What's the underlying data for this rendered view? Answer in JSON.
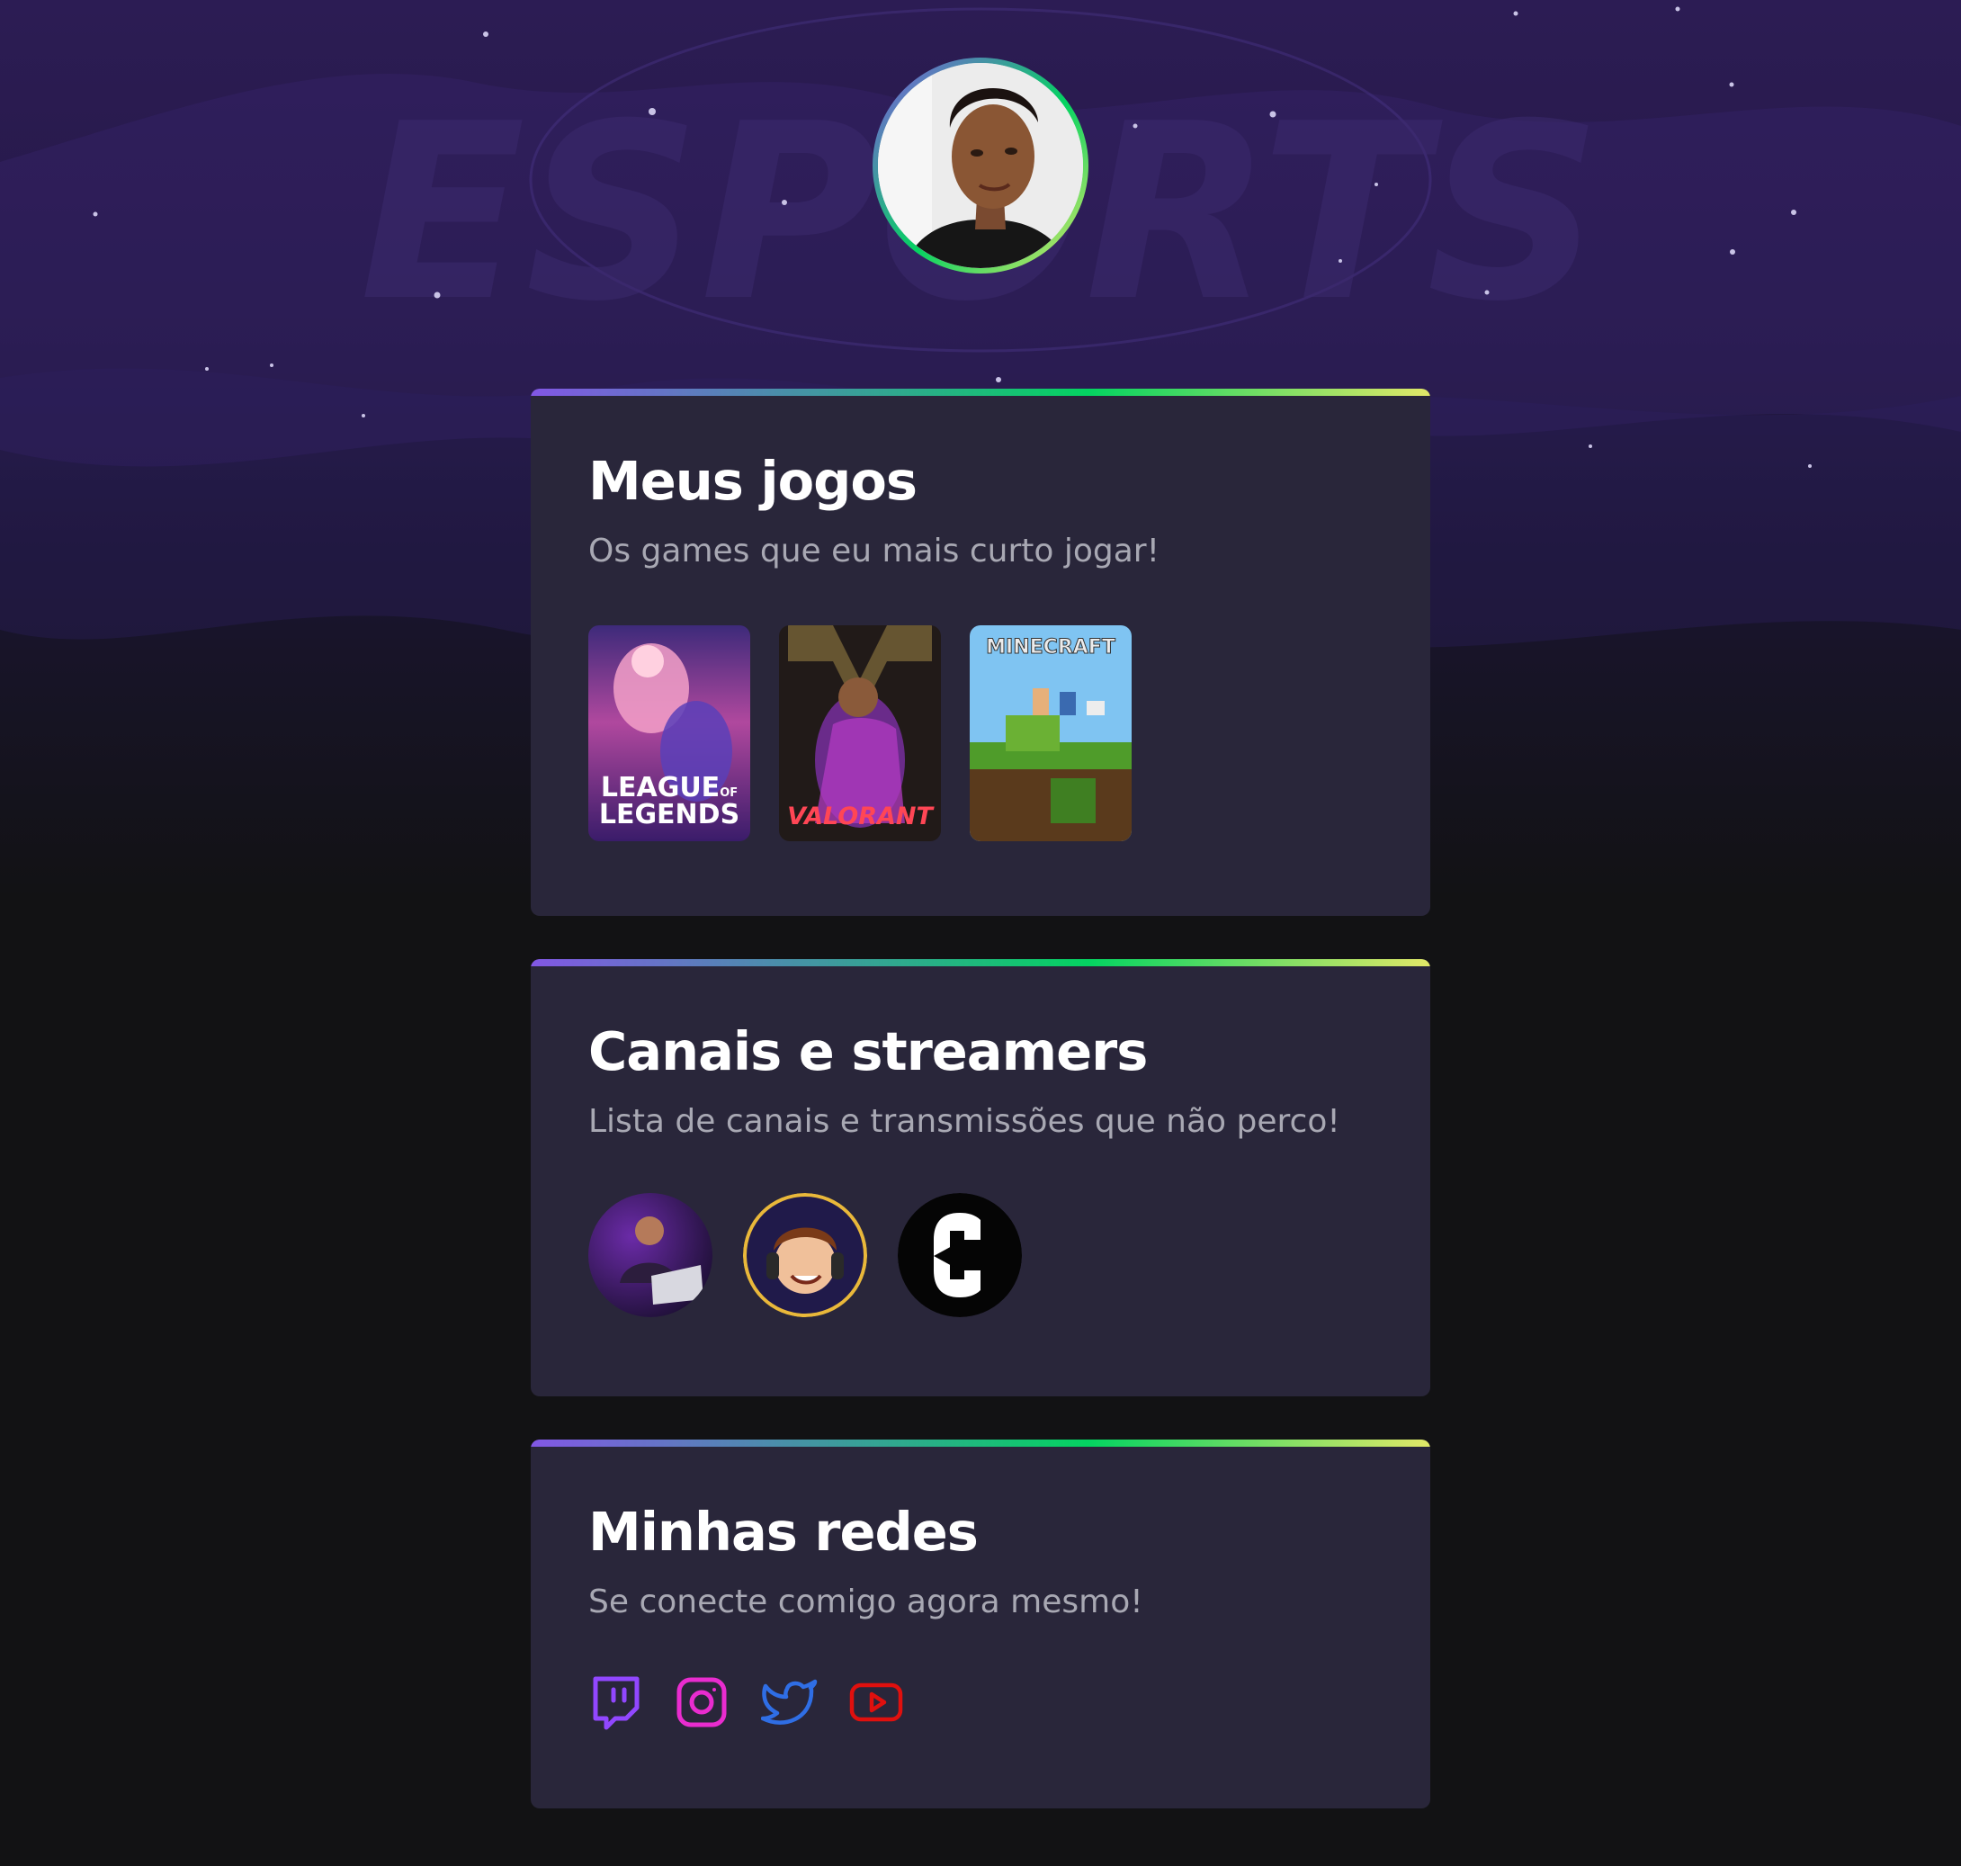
{
  "profile": {
    "avatar_icon": "profile-photo"
  },
  "background": {
    "watermark_text": "ESPORTS"
  },
  "games_card": {
    "title": "Meus jogos",
    "subtitle": "Os games que eu mais curto jogar!",
    "games": [
      {
        "name": "League of Legends",
        "label_line1": "LEAGUE",
        "label_of": "OF",
        "label_line2": "LEGENDS"
      },
      {
        "name": "Valorant",
        "label": "VALORANT"
      },
      {
        "name": "Minecraft",
        "label": "MINECRAFT"
      }
    ]
  },
  "channels_card": {
    "title": "Canais e streamers",
    "subtitle": "Lista de canais e transmissões que não perco!",
    "streamers": [
      {
        "icon": "streamer-avatar-gamer-laptop"
      },
      {
        "icon": "streamer-avatar-cartoon-headset"
      },
      {
        "icon": "streamer-avatar-c-logo"
      }
    ]
  },
  "social_card": {
    "title": "Minhas redes",
    "subtitle": "Se conecte comigo agora mesmo!",
    "links": [
      {
        "name": "twitch",
        "icon": "twitch-icon",
        "color": "#9147ff"
      },
      {
        "name": "instagram",
        "icon": "instagram-icon",
        "color": "#e92ccf"
      },
      {
        "name": "twitter",
        "icon": "twitter-icon",
        "color": "#2f6ee5"
      },
      {
        "name": "youtube",
        "icon": "youtube-icon",
        "color": "#e0100e"
      }
    ]
  },
  "colors": {
    "page_bg": "#121214",
    "card_bg": "#29263a",
    "gradient": [
      "#8257e5",
      "#04d361",
      "#e1e868"
    ],
    "title": "#ffffff",
    "subtitle": "#a8a8b3"
  }
}
